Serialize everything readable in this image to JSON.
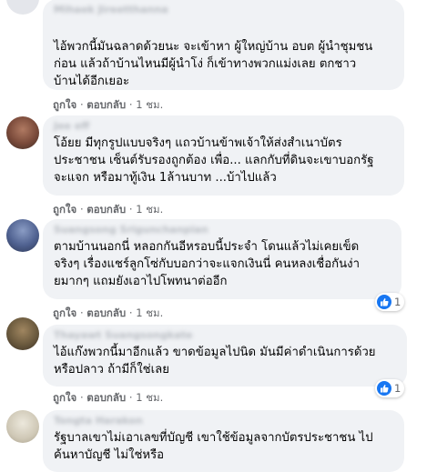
{
  "comments": [
    {
      "author": "Mihaek Jireetthanna",
      "text": "ไอ้พวกนี้มันฉลาดด้วยนะ จะเข้าหา ผู้ใหญ่บ้าน อบต ผู้นำชุมชน\nก่อน แล้วถ้าบ้านไหนมีผู้นำโง่ ก็เข้าทางพวกแม่งเลย ตกชาว\nบ้านได้อีกเยอะ",
      "like_label": "ถูกใจ",
      "reply_label": "ตอบกลับ",
      "time": "1 ชม.",
      "avatar_color": "#e4e6eb",
      "reactions": null
    },
    {
      "author": "Jee eff",
      "text": "โอ้ยย มีทุกรูปแบบจริงๆ แถวบ้านข้าพเจ้าให้ส่งสำเนาบัตร\nประชาชน เซ็นต์รับรองถูกต้อง เพื่อ... แลกกับที่ดินจะเขาบอกรัฐ\nจะแจก หรือมาทู้เงิน 1ล้านบาท ...บ้าไปแล้ว",
      "like_label": "ถูกใจ",
      "reply_label": "ตอบกลับ",
      "time": "1 ชม.",
      "avatar_color": "#8a5a4a",
      "reactions": null
    },
    {
      "author": "Suangsong Srigunchanpian",
      "text": "ตามบ้านนอกนี่ หลอกกันอีหรอบนี้ประจำ โดนแล้วไม่เคยเข็ด\nจริงๆ เรื่องแชร์ลูกโซ่กับบอกว่าจะแจกเงินนี่ คนหลงเชื่อกันง่า\nยมากๆ แถมยังเอาไปโพทนาต่ออีก",
      "like_label": "ถูกใจ",
      "reply_label": "ตอบกลับ",
      "time": "1 ชม.",
      "avatar_color": "#5a6f9a",
      "reactions": {
        "count": "1",
        "icon": "like-icon"
      }
    },
    {
      "author": "Thayawt Suangsongkate",
      "text": "ไอ้แก๊งพวกนี้มาอีกแล้ว ขาดข้อมูลไปนิด มันมีค่าดำเนินการด้วย\nหรือปลาว ถ้ามีก็ใช่เลย",
      "like_label": "ถูกใจ",
      "reply_label": "ตอบกลับ",
      "time": "1 ชม.",
      "avatar_color": "#6b5a3e",
      "reactions": {
        "count": "1",
        "icon": "like-icon"
      }
    },
    {
      "author": "Tongta Harakon",
      "text": "รัฐบาลเขาไม่เอาเลขที่บัญชี เขาใช้ข้อมูลจากบัตรประชาชน ไป\nค้นหาบัญชี ไม่ใช่หรือ",
      "like_label": null,
      "reply_label": null,
      "time": null,
      "avatar_color": "#d8d4c8",
      "reactions": null
    }
  ],
  "colors": {
    "bubble": "#f0f2f5",
    "meta": "#65676b",
    "like_blue": "#1877f2"
  }
}
